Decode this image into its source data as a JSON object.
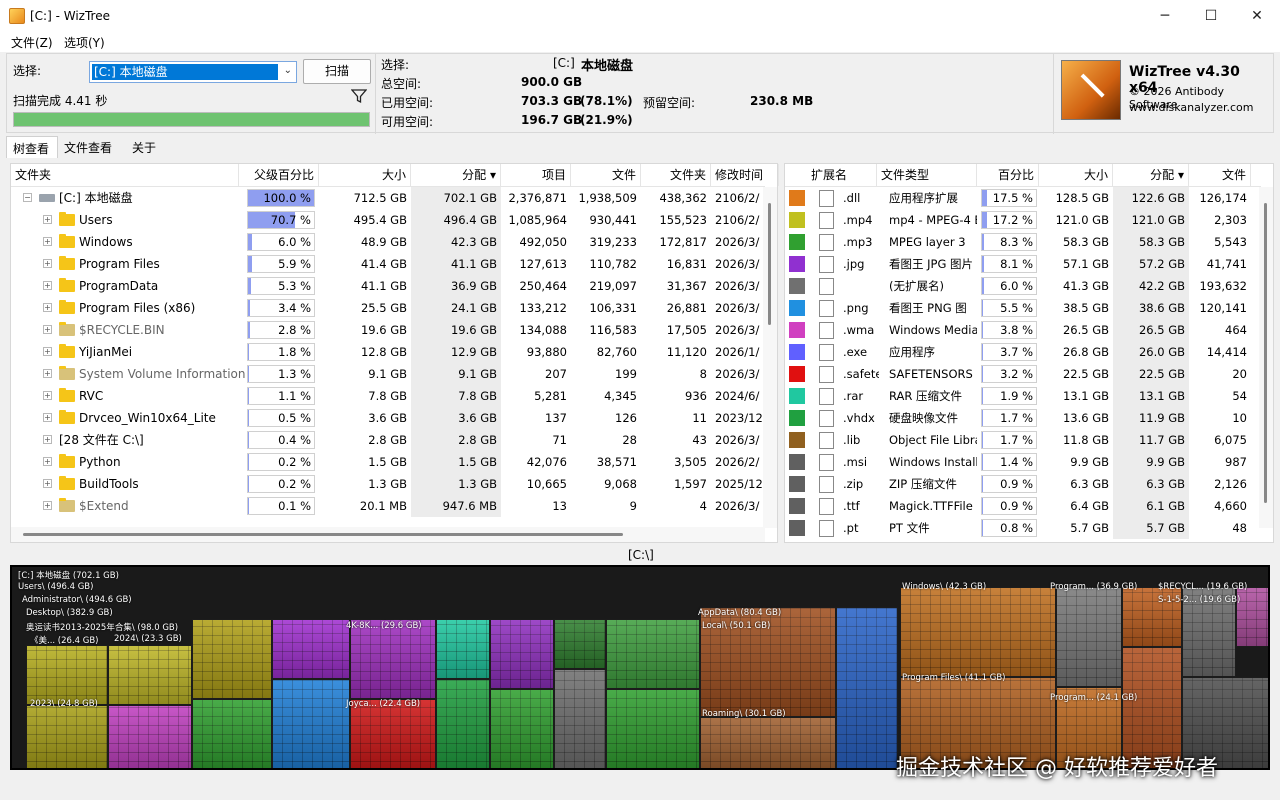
{
  "window": {
    "title": "[C:] - WizTree",
    "controls": [
      "─",
      "☐",
      "✕"
    ]
  },
  "menu": [
    "文件(Z)",
    "选项(Y)"
  ],
  "scan": {
    "select_label": "选择:",
    "drive": "[C:] 本地磁盘",
    "button": "扫描",
    "status": "扫描完成 4.41 秒",
    "progress": 1.0
  },
  "info": {
    "select_label": "选择:",
    "select_drive": "[C:]",
    "select_name": "本地磁盘",
    "total_label": "总空间:",
    "total": "900.0 GB",
    "used_label": "已用空间:",
    "used": "703.3 GB",
    "used_pct": "(78.1%)",
    "reserved_label": "预留空间:",
    "reserved": "230.8 MB",
    "free_label": "可用空间:",
    "free": "196.7 GB",
    "free_pct": "(21.9%)"
  },
  "logo": {
    "title": "WizTree v4.30 x64",
    "copyright": "© 2026 Antibody Software",
    "site": "www.diskanalyzer.com"
  },
  "tabs": [
    "树查看",
    "文件查看",
    "关于"
  ],
  "tree": {
    "headers": [
      "文件夹",
      "父级百分比",
      "大小",
      "分配",
      "项目",
      "文件",
      "文件夹",
      "修改时间"
    ],
    "rows": [
      {
        "name": "[C:] 本地磁盘",
        "icon": "drive",
        "level": 0,
        "expander": "−",
        "pct": "100.0 %",
        "pctv": 1.0,
        "size": "712.5 GB",
        "alloc": "702.1 GB",
        "items": "2,376,871",
        "files": "1,938,509",
        "folders": "438,362",
        "mod": "2106/2/"
      },
      {
        "name": "Users",
        "icon": "folder",
        "level": 1,
        "expander": "+",
        "pct": "70.7 %",
        "pctv": 0.707,
        "size": "495.4 GB",
        "alloc": "496.4 GB",
        "items": "1,085,964",
        "files": "930,441",
        "folders": "155,523",
        "mod": "2106/2/"
      },
      {
        "name": "Windows",
        "icon": "folder",
        "level": 1,
        "expander": "+",
        "pct": "6.0 %",
        "pctv": 0.06,
        "size": "48.9 GB",
        "alloc": "42.3 GB",
        "items": "492,050",
        "files": "319,233",
        "folders": "172,817",
        "mod": "2026/3/"
      },
      {
        "name": "Program Files",
        "icon": "folder",
        "level": 1,
        "expander": "+",
        "pct": "5.9 %",
        "pctv": 0.059,
        "size": "41.4 GB",
        "alloc": "41.1 GB",
        "items": "127,613",
        "files": "110,782",
        "folders": "16,831",
        "mod": "2026/3/"
      },
      {
        "name": "ProgramData",
        "icon": "folder",
        "level": 1,
        "expander": "+",
        "pct": "5.3 %",
        "pctv": 0.053,
        "size": "41.1 GB",
        "alloc": "36.9 GB",
        "items": "250,464",
        "files": "219,097",
        "folders": "31,367",
        "mod": "2026/3/"
      },
      {
        "name": "Program Files (x86)",
        "icon": "folder",
        "level": 1,
        "expander": "+",
        "pct": "3.4 %",
        "pctv": 0.034,
        "size": "25.5 GB",
        "alloc": "24.1 GB",
        "items": "133,212",
        "files": "106,331",
        "folders": "26,881",
        "mod": "2026/3/"
      },
      {
        "name": "$RECYCLE.BIN",
        "icon": "gear",
        "level": 1,
        "expander": "+",
        "pct": "2.8 %",
        "pctv": 0.028,
        "size": "19.6 GB",
        "alloc": "19.6 GB",
        "items": "134,088",
        "files": "116,583",
        "folders": "17,505",
        "mod": "2026/3/",
        "gray": true
      },
      {
        "name": "YiJianMei",
        "icon": "folder",
        "level": 1,
        "expander": "+",
        "pct": "1.8 %",
        "pctv": 0.018,
        "size": "12.8 GB",
        "alloc": "12.9 GB",
        "items": "93,880",
        "files": "82,760",
        "folders": "11,120",
        "mod": "2026/1/"
      },
      {
        "name": "System Volume Information",
        "icon": "gear",
        "level": 1,
        "expander": "+",
        "pct": "1.3 %",
        "pctv": 0.013,
        "size": "9.1 GB",
        "alloc": "9.1 GB",
        "items": "207",
        "files": "199",
        "folders": "8",
        "mod": "2026/3/",
        "gray": true
      },
      {
        "name": "RVC",
        "icon": "folder",
        "level": 1,
        "expander": "+",
        "pct": "1.1 %",
        "pctv": 0.011,
        "size": "7.8 GB",
        "alloc": "7.8 GB",
        "items": "5,281",
        "files": "4,345",
        "folders": "936",
        "mod": "2024/6/"
      },
      {
        "name": "Drvceo_Win10x64_Lite",
        "icon": "folder",
        "level": 1,
        "expander": "+",
        "pct": "0.5 %",
        "pctv": 0.005,
        "size": "3.6 GB",
        "alloc": "3.6 GB",
        "items": "137",
        "files": "126",
        "folders": "11",
        "mod": "2023/12"
      },
      {
        "name": "[28 文件在 C:\\]",
        "icon": "none",
        "level": 1,
        "expander": "+",
        "pct": "0.4 %",
        "pctv": 0.004,
        "size": "2.8 GB",
        "alloc": "2.8 GB",
        "items": "71",
        "files": "28",
        "folders": "43",
        "mod": "2026/3/"
      },
      {
        "name": "Python",
        "icon": "folder",
        "level": 1,
        "expander": "+",
        "pct": "0.2 %",
        "pctv": 0.002,
        "size": "1.5 GB",
        "alloc": "1.5 GB",
        "items": "42,076",
        "files": "38,571",
        "folders": "3,505",
        "mod": "2026/2/"
      },
      {
        "name": "BuildTools",
        "icon": "folder",
        "level": 1,
        "expander": "+",
        "pct": "0.2 %",
        "pctv": 0.002,
        "size": "1.3 GB",
        "alloc": "1.3 GB",
        "items": "10,665",
        "files": "9,068",
        "folders": "1,597",
        "mod": "2025/12"
      },
      {
        "name": "$Extend",
        "icon": "gear",
        "level": 1,
        "expander": "+",
        "pct": "0.1 %",
        "pctv": 0.001,
        "size": "20.1 MB",
        "alloc": "947.6 MB",
        "items": "13",
        "files": "9",
        "folders": "4",
        "mod": "2026/3/",
        "gray": true
      }
    ]
  },
  "ext": {
    "headers": [
      "扩展名",
      "文件类型",
      "百分比",
      "大小",
      "分配",
      "文件"
    ],
    "rows": [
      {
        "color": "#e07a1a",
        "ext": ".dll",
        "type": "应用程序扩展",
        "pct": "17.5 %",
        "pctv": 0.175,
        "size": "128.5 GB",
        "alloc": "122.6 GB",
        "files": "126,174"
      },
      {
        "color": "#c0c020",
        "ext": ".mp4",
        "type": "mp4 - MPEG-4 E",
        "pct": "17.2 %",
        "pctv": 0.172,
        "size": "121.0 GB",
        "alloc": "121.0 GB",
        "files": "2,303"
      },
      {
        "color": "#30a030",
        "ext": ".mp3",
        "type": "MPEG layer 3",
        "pct": "8.3 %",
        "pctv": 0.083,
        "size": "58.3 GB",
        "alloc": "58.3 GB",
        "files": "5,543"
      },
      {
        "color": "#9030d0",
        "ext": ".jpg",
        "type": "看图王 JPG 图片",
        "pct": "8.1 %",
        "pctv": 0.081,
        "size": "57.1 GB",
        "alloc": "57.2 GB",
        "files": "41,741"
      },
      {
        "color": "#707070",
        "ext": "",
        "type": "(无扩展名)",
        "pct": "6.0 %",
        "pctv": 0.06,
        "size": "41.3 GB",
        "alloc": "42.2 GB",
        "files": "193,632"
      },
      {
        "color": "#2090e0",
        "ext": ".png",
        "type": "看图王 PNG 图",
        "pct": "5.5 %",
        "pctv": 0.055,
        "size": "38.5 GB",
        "alloc": "38.6 GB",
        "files": "120,141"
      },
      {
        "color": "#d040c0",
        "ext": ".wma",
        "type": "Windows Media",
        "pct": "3.8 %",
        "pctv": 0.038,
        "size": "26.5 GB",
        "alloc": "26.5 GB",
        "files": "464"
      },
      {
        "color": "#6060ff",
        "ext": ".exe",
        "type": "应用程序",
        "pct": "3.7 %",
        "pctv": 0.037,
        "size": "26.8 GB",
        "alloc": "26.0 GB",
        "files": "14,414"
      },
      {
        "color": "#e01010",
        "ext": ".safete",
        "type": "SAFETENSORS 文",
        "pct": "3.2 %",
        "pctv": 0.032,
        "size": "22.5 GB",
        "alloc": "22.5 GB",
        "files": "20"
      },
      {
        "color": "#20c8a0",
        "ext": ".rar",
        "type": "RAR 压缩文件",
        "pct": "1.9 %",
        "pctv": 0.019,
        "size": "13.1 GB",
        "alloc": "13.1 GB",
        "files": "54"
      },
      {
        "color": "#20a040",
        "ext": ".vhdx",
        "type": "硬盘映像文件",
        "pct": "1.7 %",
        "pctv": 0.017,
        "size": "13.6 GB",
        "alloc": "11.9 GB",
        "files": "10"
      },
      {
        "color": "#906020",
        "ext": ".lib",
        "type": "Object File Libra",
        "pct": "1.7 %",
        "pctv": 0.017,
        "size": "11.8 GB",
        "alloc": "11.7 GB",
        "files": "6,075"
      },
      {
        "color": "#606060",
        "ext": ".msi",
        "type": "Windows Installe",
        "pct": "1.4 %",
        "pctv": 0.014,
        "size": "9.9 GB",
        "alloc": "9.9 GB",
        "files": "987"
      },
      {
        "color": "#606060",
        "ext": ".zip",
        "type": "ZIP 压缩文件",
        "pct": "0.9 %",
        "pctv": 0.009,
        "size": "6.3 GB",
        "alloc": "6.3 GB",
        "files": "2,126"
      },
      {
        "color": "#606060",
        "ext": ".ttf",
        "type": "Magick.TTFFile",
        "pct": "0.9 %",
        "pctv": 0.009,
        "size": "6.4 GB",
        "alloc": "6.1 GB",
        "files": "4,660"
      },
      {
        "color": "#606060",
        "ext": ".pt",
        "type": "PT 文件",
        "pct": "0.8 %",
        "pctv": 0.008,
        "size": "5.7 GB",
        "alloc": "5.7 GB",
        "files": "48"
      }
    ]
  },
  "path_label": "[C:\\]",
  "treemap": {
    "labels": [
      "[C:] 本地磁盘 (702.1 GB)",
      "Users\\ (496.4 GB)",
      "Administrator\\ (494.6 GB)",
      "Desktop\\ (382.9 GB)",
      "奥运读书2013-2025年合集\\ (98.0 GB)",
      "《美... (26.4 GB)",
      "2024\\ (23.3 GB)",
      "2023\\ (24.8 GB)",
      "4K-8K... (29.6 GB)",
      "Joyca... (22.4 GB)",
      "AppData\\ (80.4 GB)",
      "Local\\ (50.1 GB)",
      "Roaming\\ (30.1 GB)",
      "Windows\\ (42.3 GB)",
      "Program Files\\ (41.1 GB)",
      "Program... (36.9 GB)",
      "Program... (24.1 GB)",
      "$RECYCL... (19.6 GB)",
      "S-1-5-2... (19.6 GB)"
    ]
  },
  "watermark": "掘金技术社区 @ 好软推荐爱好者"
}
